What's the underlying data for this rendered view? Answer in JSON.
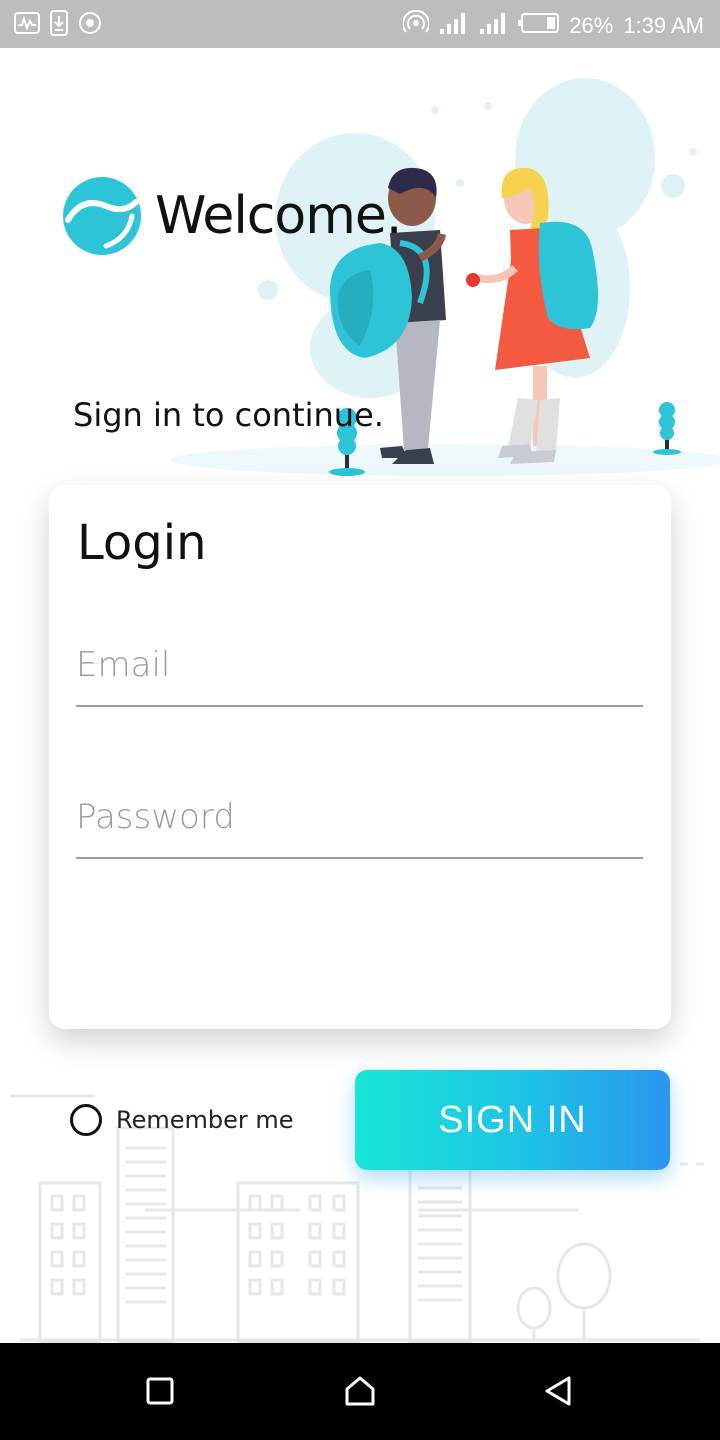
{
  "status_bar": {
    "battery": "26%",
    "time": "1:39 AM",
    "left_icons": [
      "activity-icon",
      "download-icon",
      "target-icon"
    ],
    "right_icons": [
      "hotspot-icon",
      "signal-icon",
      "signal-ht-icon",
      "battery-icon"
    ]
  },
  "header": {
    "welcome": "Welcome.",
    "subtitle": "Sign in to continue."
  },
  "login": {
    "title": "Login",
    "email_placeholder": "Email",
    "email_value": "",
    "password_placeholder": "Password",
    "password_value": ""
  },
  "remember_me": "Remember me",
  "sign_in": "SIGN IN",
  "colors": {
    "accent_start": "#18e6d6",
    "accent_end": "#2a95ef",
    "illustration_teal": "#2ec4d8",
    "dress_red": "#f35a3f"
  },
  "nav": [
    "recents-icon",
    "home-icon",
    "back-icon"
  ]
}
